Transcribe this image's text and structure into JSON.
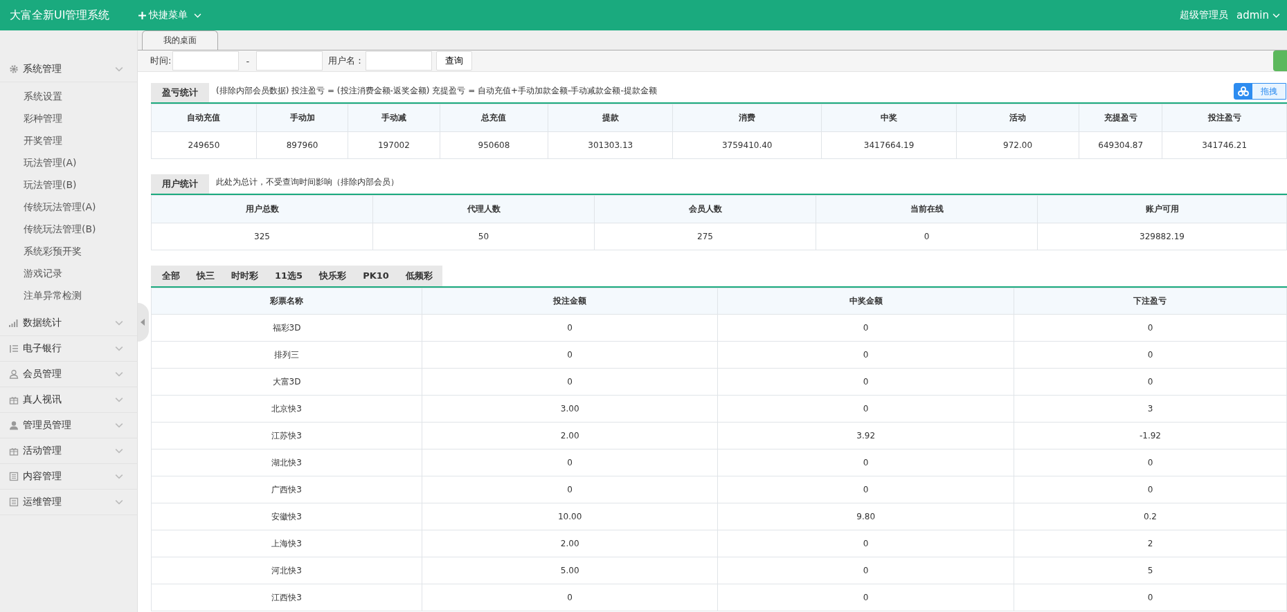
{
  "header": {
    "title": "大富全新UI管理系统",
    "quick_menu": "快捷菜单",
    "role": "超级管理员",
    "user": "admin"
  },
  "sidebar": {
    "items": [
      {
        "label": "系统管理",
        "children": [
          {
            "label": "系统设置"
          },
          {
            "label": "彩种管理"
          },
          {
            "label": "开奖管理"
          },
          {
            "label": "玩法管理(A)"
          },
          {
            "label": "玩法管理(B)"
          },
          {
            "label": "传统玩法管理(A)"
          },
          {
            "label": "传统玩法管理(B)"
          },
          {
            "label": "系统彩预开奖"
          },
          {
            "label": "游戏记录"
          },
          {
            "label": "注单异常检测"
          }
        ]
      },
      {
        "label": "数据统计"
      },
      {
        "label": "电子银行"
      },
      {
        "label": "会员管理"
      },
      {
        "label": "真人视讯"
      },
      {
        "label": "管理员管理"
      },
      {
        "label": "活动管理"
      },
      {
        "label": "内容管理"
      },
      {
        "label": "运维管理"
      }
    ]
  },
  "page_tabs": [
    {
      "label": "我的桌面"
    }
  ],
  "filter": {
    "time_label": "时间:",
    "separator": "-",
    "user_label": "用户名：",
    "query_button": "查询"
  },
  "upload_widget": {
    "label": "拖拽"
  },
  "profit_stats": {
    "title": "盈亏统计",
    "note": "(排除内部会员数据)  投注盈亏 = (投注消费金额-返奖金额)     充提盈亏 = 自动充值+手动加款金额-手动减款金额-提款金额",
    "columns": [
      "自动充值",
      "手动加",
      "手动减",
      "总充值",
      "提款",
      "消费",
      "中奖",
      "活动",
      "充提盈亏",
      "投注盈亏"
    ],
    "rows": [
      [
        "249650",
        "897960",
        "197002",
        "950608",
        "301303.13",
        "3759410.40",
        "3417664.19",
        "972.00",
        "649304.87",
        "341746.21"
      ]
    ]
  },
  "user_stats": {
    "title": "用户统计",
    "note": "此处为总计，不受查询时间影响（排除内部会员）",
    "columns": [
      "用户总数",
      "代理人数",
      "会员人数",
      "当前在线",
      "账户可用"
    ],
    "rows": [
      [
        "325",
        "50",
        "275",
        "0",
        "329882.19"
      ]
    ]
  },
  "lottery": {
    "tabs": [
      {
        "label": "全部"
      },
      {
        "label": "快三"
      },
      {
        "label": "时时彩"
      },
      {
        "label": "11选5"
      },
      {
        "label": "快乐彩"
      },
      {
        "label": "PK10"
      },
      {
        "label": "低频彩"
      }
    ],
    "columns": [
      "彩票名称",
      "投注金额",
      "中奖金额",
      "下注盈亏"
    ],
    "rows": [
      [
        "福彩3D",
        "0",
        "0",
        "0"
      ],
      [
        "排列三",
        "0",
        "0",
        "0"
      ],
      [
        "大富3D",
        "0",
        "0",
        "0"
      ],
      [
        "北京快3",
        "3.00",
        "0",
        "3"
      ],
      [
        "江苏快3",
        "2.00",
        "3.92",
        "-1.92"
      ],
      [
        "湖北快3",
        "0",
        "0",
        "0"
      ],
      [
        "广西快3",
        "0",
        "0",
        "0"
      ],
      [
        "安徽快3",
        "10.00",
        "9.80",
        "0.2"
      ],
      [
        "上海快3",
        "2.00",
        "0",
        "2"
      ],
      [
        "河北快3",
        "5.00",
        "0",
        "5"
      ],
      [
        "江西快3",
        "0",
        "0",
        "0"
      ]
    ]
  }
}
